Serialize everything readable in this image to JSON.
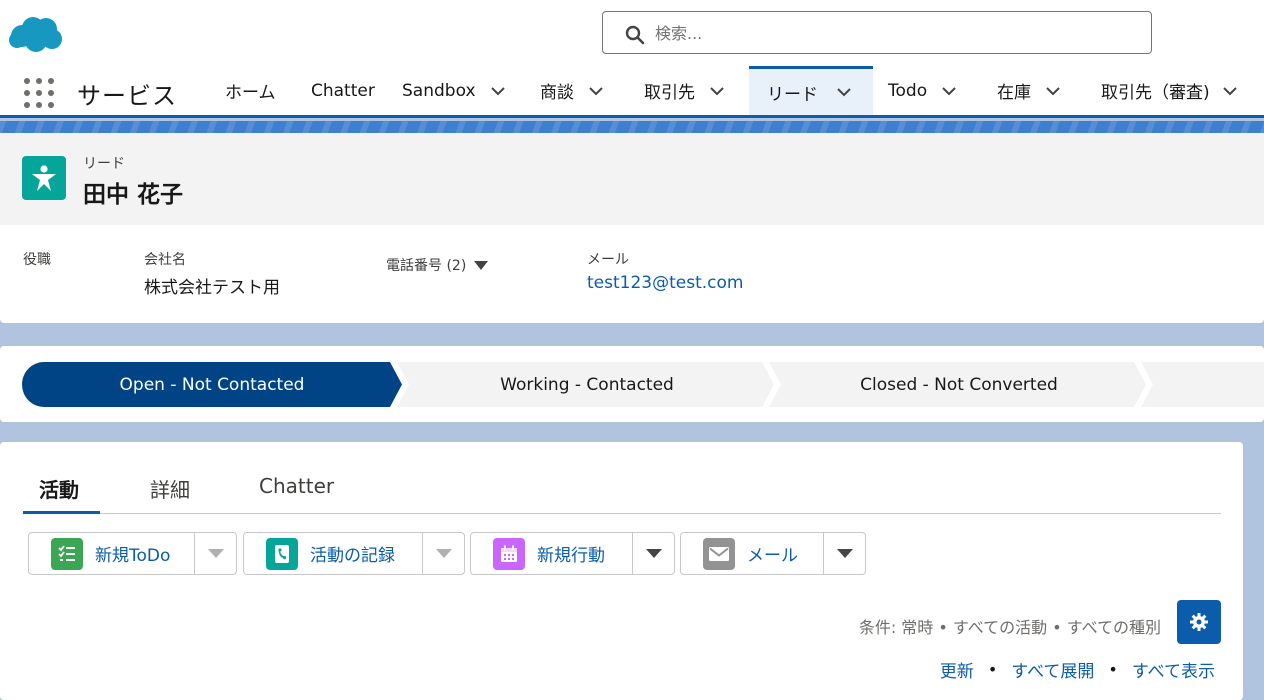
{
  "header": {
    "search_placeholder": "検索..."
  },
  "nav": {
    "app_name": "サービス",
    "items": [
      {
        "label": "ホーム"
      },
      {
        "label": "Chatter"
      },
      {
        "label": "Sandbox"
      },
      {
        "label": "商談"
      },
      {
        "label": "取引先"
      },
      {
        "label": "リード"
      },
      {
        "label": "Todo"
      },
      {
        "label": "在庫"
      },
      {
        "label": "取引先（審査)"
      }
    ],
    "active_item": "リード"
  },
  "record": {
    "type_label": "リード",
    "name": "田中 花子",
    "fields": {
      "title_label": "役職",
      "company_label": "会社名",
      "company_value": "株式会社テスト用",
      "phone_label": "電話番号 (2)",
      "email_label": "メール",
      "email_value": "test123@test.com"
    }
  },
  "path": {
    "stages": [
      {
        "label": "Open - Not Contacted",
        "state": "current"
      },
      {
        "label": "Working - Contacted",
        "state": "incomplete"
      },
      {
        "label": "Closed - Not Converted",
        "state": "incomplete"
      },
      {
        "label": "",
        "state": "incomplete"
      }
    ]
  },
  "activity": {
    "tabs": [
      {
        "label": "活動"
      },
      {
        "label": "詳細"
      },
      {
        "label": "Chatter"
      }
    ],
    "active_tab": "活動",
    "actions": [
      {
        "label": "新規ToDo",
        "icon": "task-icon",
        "color": "#3ba755"
      },
      {
        "label": "活動の記録",
        "icon": "log-call-icon",
        "color": "#06a59a"
      },
      {
        "label": "新規行動",
        "icon": "calendar-icon",
        "color": "#cb65ff"
      },
      {
        "label": "メール",
        "icon": "email-icon",
        "color": "#939393"
      }
    ],
    "filter_text": "条件: 常時 • すべての活動 • すべての種別",
    "links": {
      "refresh": "更新",
      "expand_all": "すべて展開",
      "view_all": "すべて表示"
    }
  },
  "colors": {
    "brand": "#0b5cab",
    "path_current": "#014486",
    "path_incomplete": "#f3f3f3"
  }
}
